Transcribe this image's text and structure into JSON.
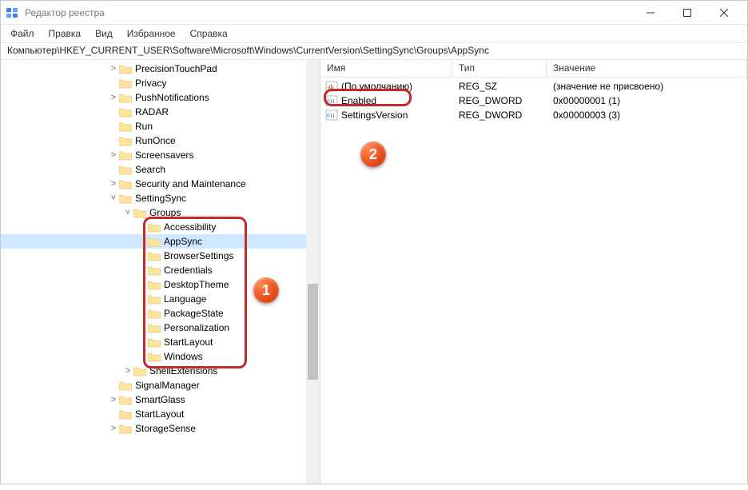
{
  "window": {
    "title": "Редактор реестра"
  },
  "menu": {
    "file": "Файл",
    "edit": "Правка",
    "view": "Вид",
    "favorites": "Избранное",
    "help": "Справка"
  },
  "address": "Компьютер\\HKEY_CURRENT_USER\\Software\\Microsoft\\Windows\\CurrentVersion\\SettingSync\\Groups\\AppSync",
  "tree": {
    "upper": [
      {
        "label": "PrecisionTouchPad",
        "twisty": ">"
      },
      {
        "label": "Privacy",
        "twisty": ""
      },
      {
        "label": "PushNotifications",
        "twisty": ">"
      },
      {
        "label": "RADAR",
        "twisty": ""
      },
      {
        "label": "Run",
        "twisty": ""
      },
      {
        "label": "RunOnce",
        "twisty": ""
      },
      {
        "label": "Screensavers",
        "twisty": ">"
      },
      {
        "label": "Search",
        "twisty": ""
      },
      {
        "label": "Security and Maintenance",
        "twisty": ">"
      }
    ],
    "setting_sync_label": "SettingSync",
    "groups_label": "Groups",
    "groups": [
      {
        "label": "Accessibility"
      },
      {
        "label": "AppSync",
        "selected": true
      },
      {
        "label": "BrowserSettings"
      },
      {
        "label": "Credentials"
      },
      {
        "label": "DesktopTheme"
      },
      {
        "label": "Language"
      },
      {
        "label": "PackageState"
      },
      {
        "label": "Personalization"
      },
      {
        "label": "StartLayout"
      },
      {
        "label": "Windows"
      }
    ],
    "shell_ext_label": "ShellExtensions",
    "lower": [
      {
        "label": "SignalManager",
        "twisty": ""
      },
      {
        "label": "SmartGlass",
        "twisty": ">"
      },
      {
        "label": "StartLayout",
        "twisty": ""
      },
      {
        "label": "StorageSense",
        "twisty": ">"
      }
    ]
  },
  "list": {
    "cols": {
      "name": "Имя",
      "type": "Тип",
      "value": "Значение"
    },
    "rows": [
      {
        "name": "(По умолчанию)",
        "type": "REG_SZ",
        "value": "(значение не присвоено)",
        "icon": "sz"
      },
      {
        "name": "Enabled",
        "type": "REG_DWORD",
        "value": "0x00000001 (1)",
        "icon": "dw"
      },
      {
        "name": "SettingsVersion",
        "type": "REG_DWORD",
        "value": "0x00000003 (3)",
        "icon": "dw"
      }
    ]
  },
  "callouts": {
    "one": "1",
    "two": "2"
  }
}
